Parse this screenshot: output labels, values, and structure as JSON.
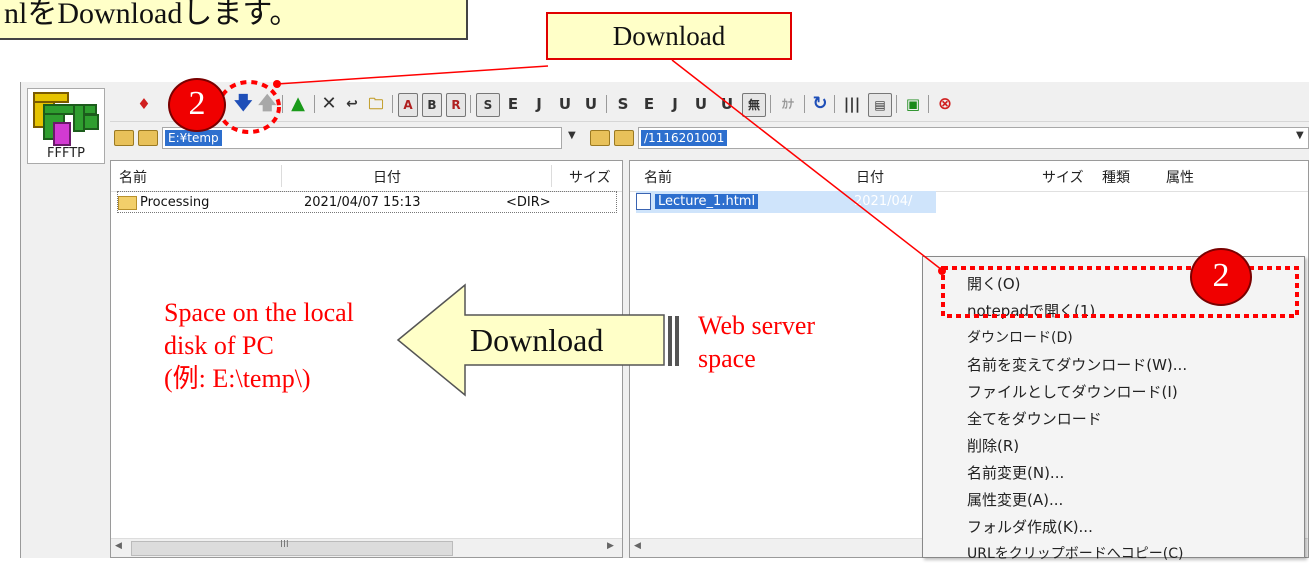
{
  "callouts": {
    "top_left": "nlをDownloadします。",
    "download": "Download"
  },
  "app": {
    "logo_label": "FFFTP",
    "toolbar": {
      "b1": "A",
      "b2": "B",
      "b3": "R",
      "s1": "S",
      "e1": "E",
      "j1": "J",
      "u1": "U",
      "u2": "U",
      "s2": "S",
      "e2": "E",
      "j2": "J",
      "u3": "U",
      "u4": "U",
      "mu": "無",
      "kana": "ｶﾅ"
    },
    "local_path": "E:¥temp",
    "remote_path": "/1116201001",
    "local_pane": {
      "columns": {
        "name": "名前",
        "date": "日付",
        "size": "サイズ"
      },
      "rows": [
        {
          "name": "Processing",
          "date": "2021/04/07 15:13",
          "size": "<DIR>"
        }
      ],
      "scroll_mark": "III"
    },
    "remote_pane": {
      "columns": {
        "name": "名前",
        "date": "日付",
        "size": "サイズ",
        "type": "種類",
        "attr": "属性"
      },
      "rows": [
        {
          "name": "Lecture_1.html",
          "date": "2021/04/"
        }
      ]
    }
  },
  "context_menu": {
    "items": [
      "開く(O)",
      "notepadで開く(1)",
      "ダウンロード(D)",
      "名前を変えてダウンロード(W)...",
      "ファイルとしてダウンロード(I)",
      "全てをダウンロード",
      "削除(R)",
      "名前変更(N)...",
      "属性変更(A)...",
      "フォルダ作成(K)...",
      "URLをクリップボードへコピー(C)"
    ]
  },
  "annotations": {
    "badge_number": "2",
    "local_space": [
      "Space on the local",
      "disk of PC",
      "(例: E:\\temp\\)"
    ],
    "arrow_label": "Download",
    "web_space": [
      "Web server",
      "space"
    ]
  },
  "colors": {
    "annotation_red": "#ff0000",
    "callout_fill": "#ffffc8",
    "selection_blue": "#2d6fce"
  }
}
